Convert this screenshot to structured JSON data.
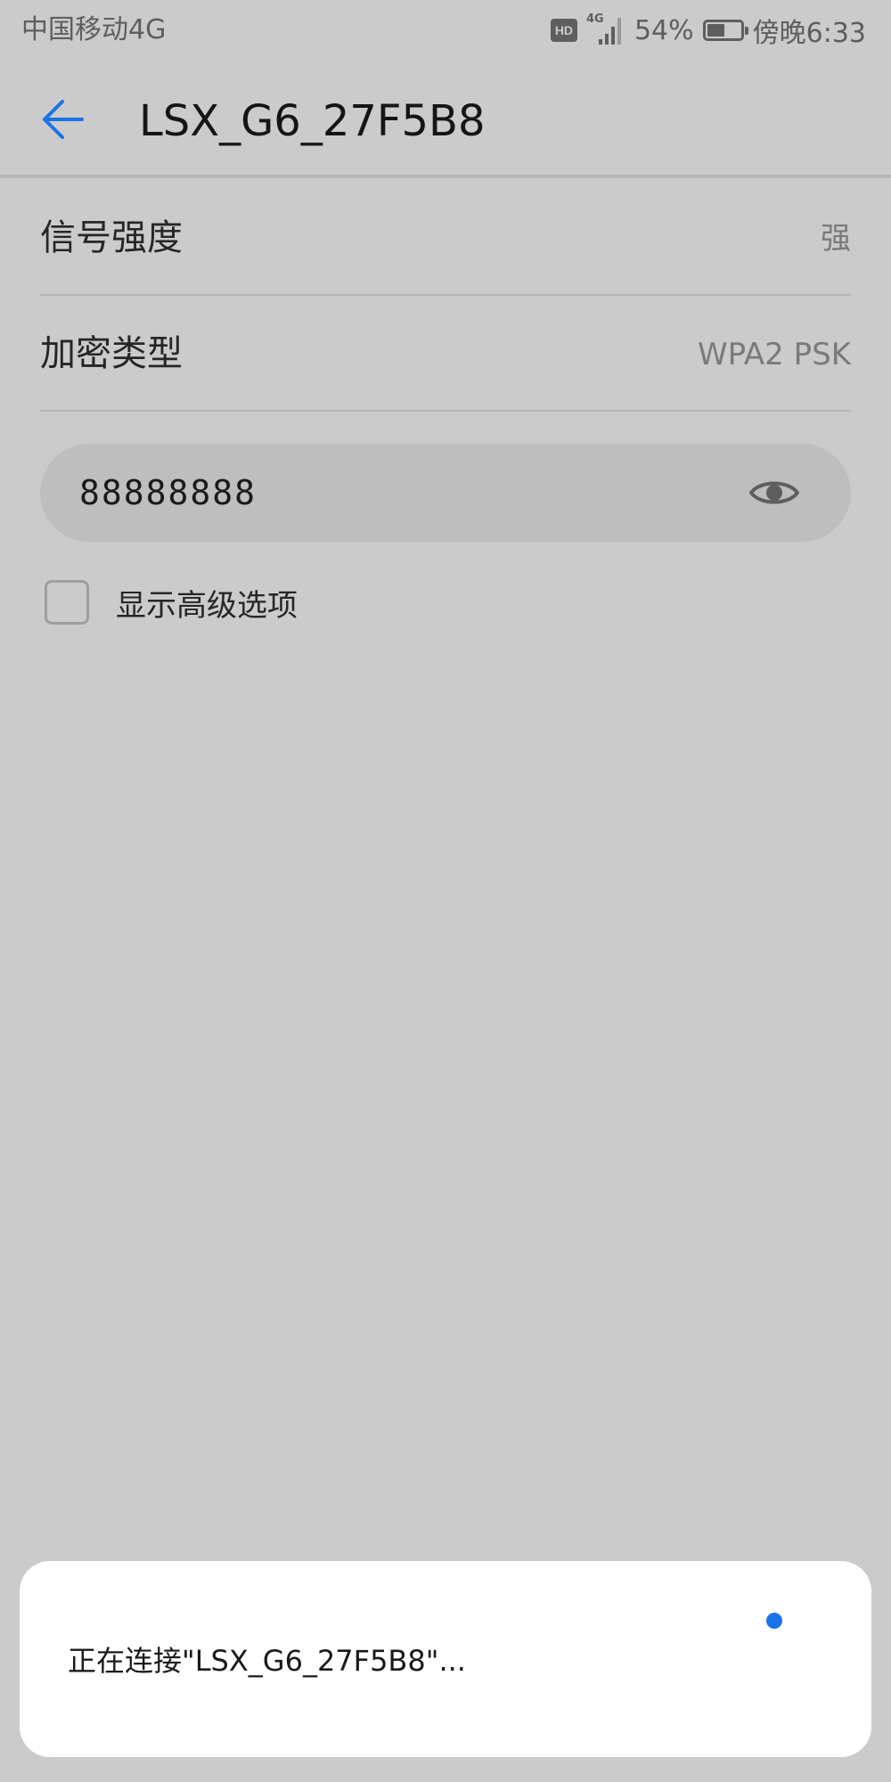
{
  "status_bar": {
    "carrier": "中国移动4G",
    "hd_label": "HD",
    "network_type": "4G",
    "battery_text": "54%",
    "battery_level": 0.54,
    "time": "傍晚6:33"
  },
  "header": {
    "back_icon": "arrow-left-icon",
    "title": "LSX_G6_27F5B8"
  },
  "details": {
    "signal_label": "信号强度",
    "signal_value": "强",
    "security_label": "加密类型",
    "security_value": "WPA2 PSK"
  },
  "password": {
    "value": "88888888",
    "visibility_icon": "eye-icon"
  },
  "advanced": {
    "label": "显示高级选项",
    "checked": false
  },
  "toast": {
    "message": "正在连接\"LSX_G6_27F5B8\"..."
  },
  "colors": {
    "background": "#cbcbcb",
    "accent": "#1a73e8",
    "text_primary": "#262626",
    "text_secondary": "#7a7a7a"
  }
}
